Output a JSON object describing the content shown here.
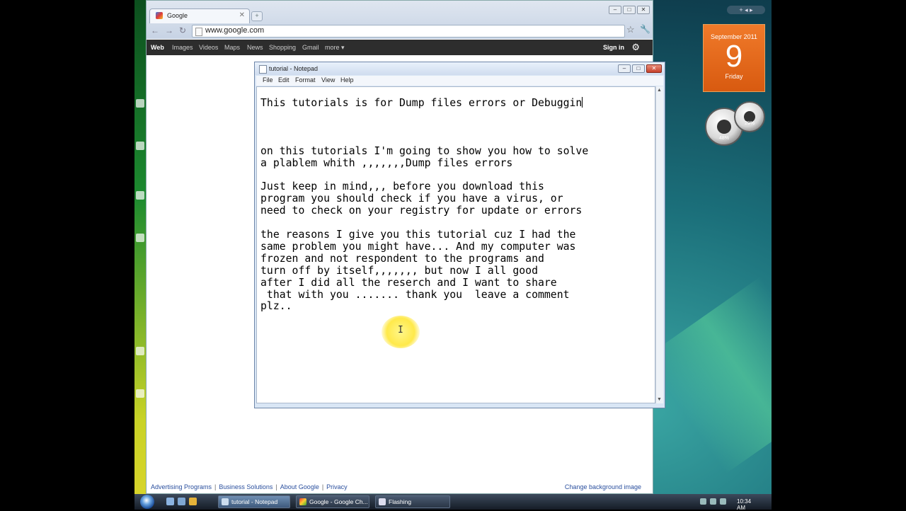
{
  "browser": {
    "tab_title": "Google",
    "url": "www.google.com",
    "gbar": {
      "items": [
        "Web",
        "Images",
        "Videos",
        "Maps",
        "News",
        "Shopping",
        "Gmail",
        "more ▾"
      ],
      "sign_in": "Sign in"
    },
    "footer": {
      "links": [
        "Advertising Programs",
        "Business Solutions",
        "About Google",
        "Privacy"
      ],
      "separator": "|",
      "change_bg": "Change background image"
    }
  },
  "notepad": {
    "title": "tutorial - Notepad",
    "menu": [
      "File",
      "Edit",
      "Format",
      "View",
      "Help"
    ],
    "lines": [
      "This tutorials is for Dump files errors or Debuggin",
      "",
      "",
      "",
      "on this tutorials I'm going to show you how to solve",
      "a plablem whith ,,,,,,,Dump files errors",
      "",
      "Just keep in mind,,, before you download this",
      "program you should check if you have a virus, or",
      "need to check on your registry for update or errors",
      "",
      "the reasons I give you this tutorial cuz I had the",
      "same problem you might have... And my computer was",
      "frozen and not respondent to the programs and",
      "turn off by itself,,,,,,, but now I all good",
      "after I did all the reserch and I want to share",
      " that with you ....... thank you  leave a comment",
      "plz.."
    ]
  },
  "calendar": {
    "month_year": "September 2011",
    "day": "9",
    "weekday": "Friday"
  },
  "meters": {
    "cpu_percent": "48%",
    "memory_percent": "29%"
  },
  "taskbar": {
    "tasks": [
      "tutorial - Notepad",
      "Google - Google Ch...",
      "Flashing"
    ],
    "clock": "10:34 AM"
  },
  "colors": {
    "calendar_orange": "#e8661c",
    "gbar": "#2d2d2d",
    "link_blue": "#2a4f9e"
  }
}
